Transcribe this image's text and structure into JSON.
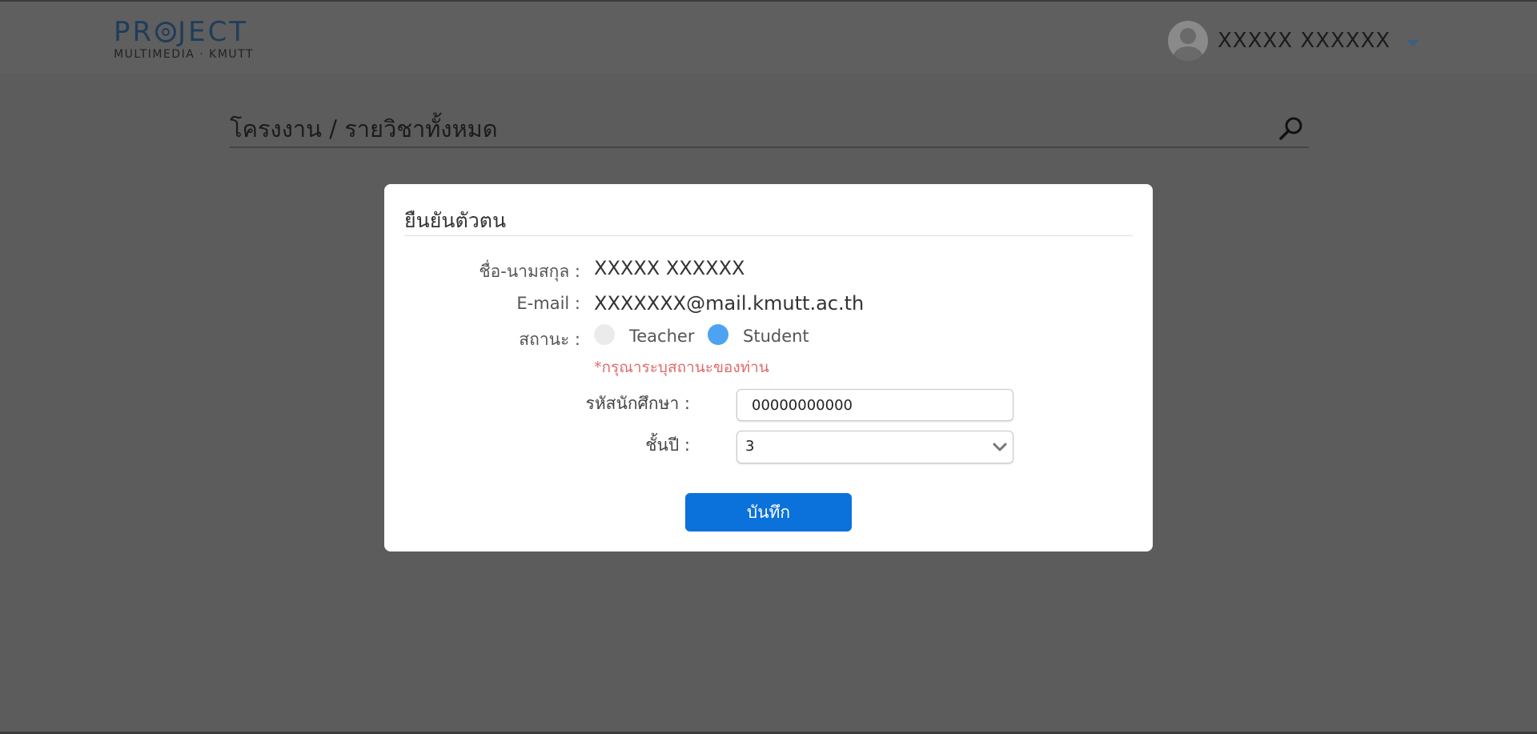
{
  "header": {
    "logo_word_pre": "PR",
    "logo_word_post": "JECT",
    "logo_subtitle": "MULTIMEDIA · KMUTT",
    "user_name": "XXXXX XXXXXX"
  },
  "page": {
    "breadcrumb": "โครงงาน / รายวิชาทั้งหมด"
  },
  "modal": {
    "title": "ยืนยันตัวตน",
    "name_label": "ชื่อ-นามสกุล :",
    "name_value": "XXXXX XXXXXX",
    "email_label": "E-mail :",
    "email_value": "XXXXXXX@mail.kmutt.ac.th",
    "status_label": "สถานะ :",
    "status_options": [
      {
        "label": "Teacher",
        "checked": false
      },
      {
        "label": "Student",
        "checked": true
      }
    ],
    "status_warning": "*กรุณาระบุสถานะของท่าน",
    "student_id_label": "รหัสนักศึกษา :",
    "student_id_value": "00000000000",
    "year_label": "ชั้นปี :",
    "year_value": "3",
    "save_label": "บันทึก"
  },
  "colors": {
    "overlay": "#5c5c5c",
    "primary_button": "#0b72dc",
    "radio_checked": "#4da3f2",
    "warning_text": "#e06b6b"
  },
  "icons": {
    "search": "search-icon",
    "avatar": "user-avatar-icon",
    "dropdown": "chevron-down-icon"
  }
}
